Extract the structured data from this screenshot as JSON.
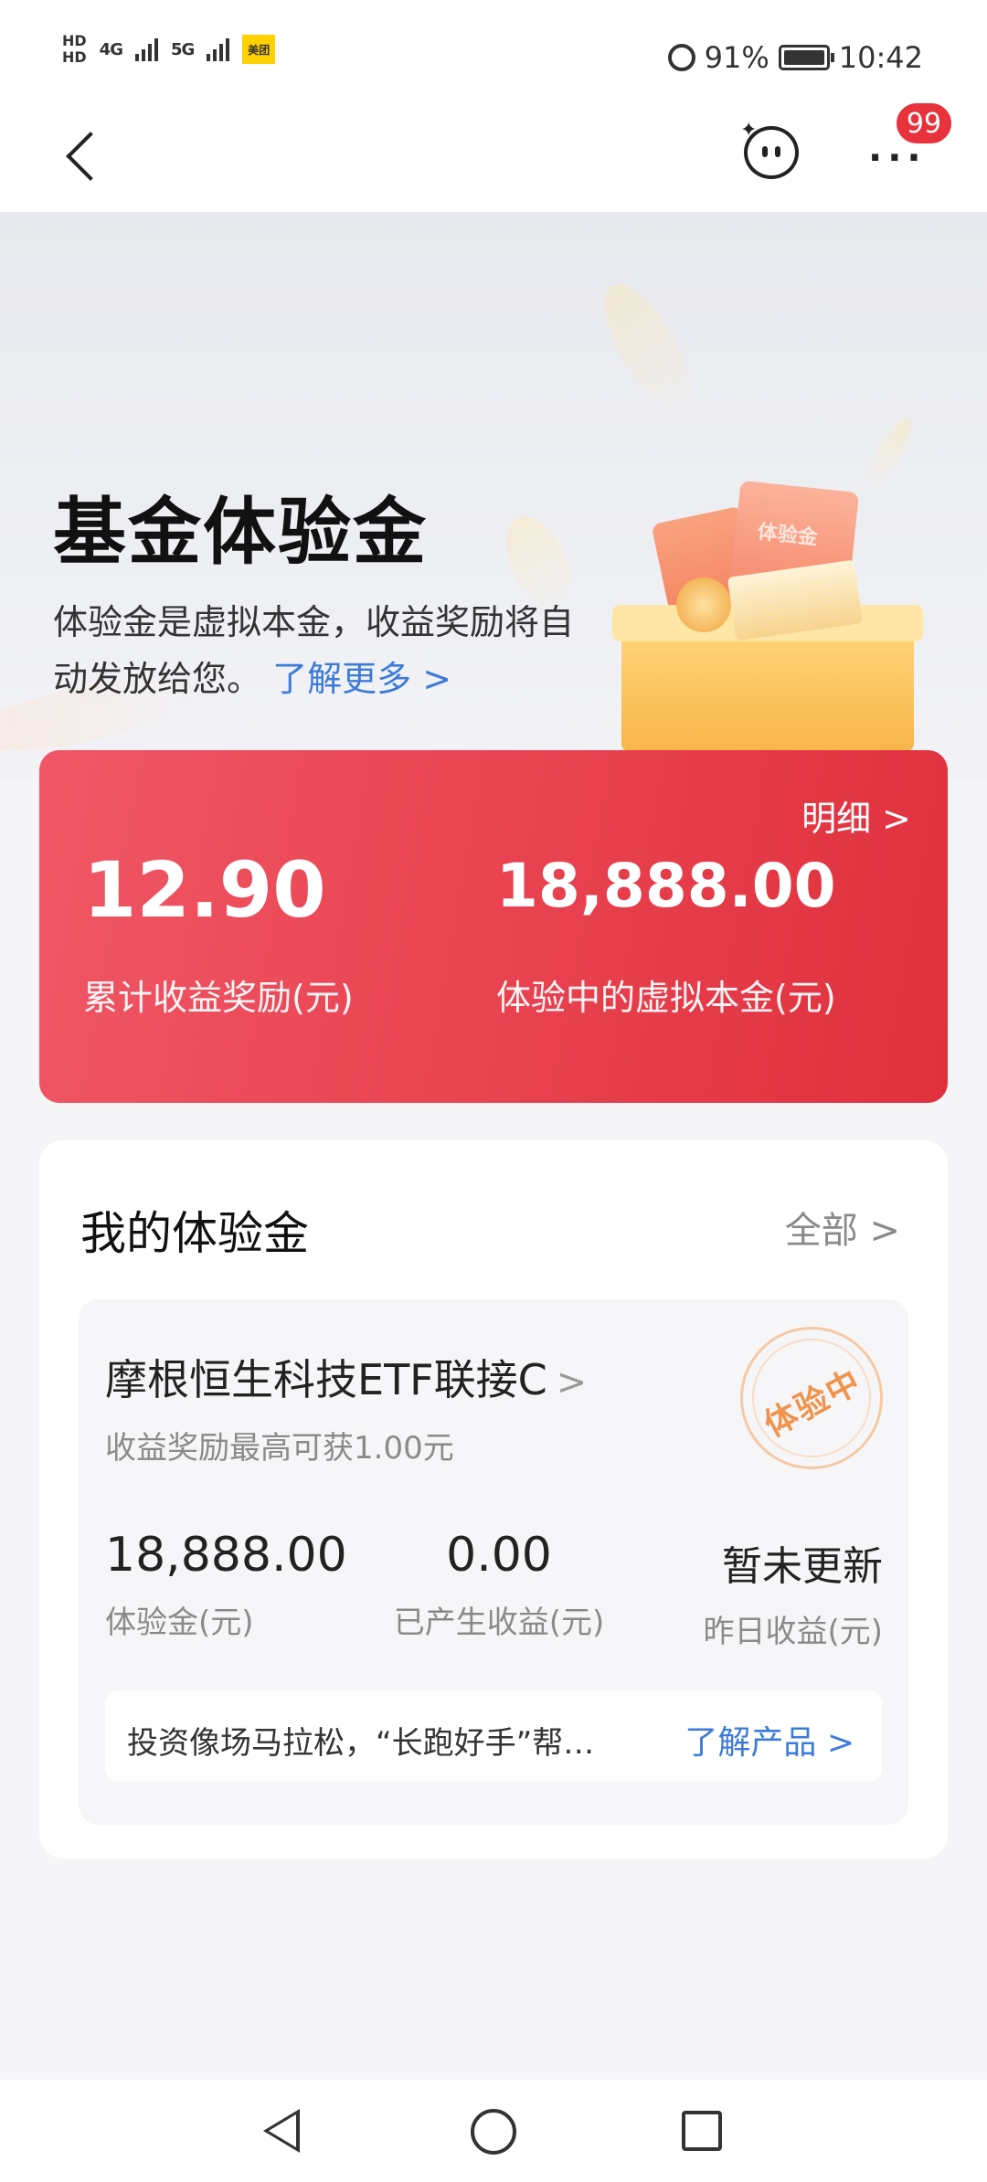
{
  "status_bar": {
    "hd1": "HD",
    "hd2": "HD",
    "net1": "4G",
    "net2": "5G",
    "app_badge": "美团",
    "battery": "91%",
    "time": "10:42"
  },
  "nav": {
    "badge_count": "99",
    "more_label": "···"
  },
  "hero": {
    "title": "基金体验金",
    "desc": "体验金是虚拟本金，收益奖励将自动发放给您。",
    "learn_more": "了解更多 >",
    "ticket_label": "体验金"
  },
  "summary": {
    "detail_link": "明细 >",
    "total_reward": "12.90",
    "total_reward_label": "累计收益奖励(元)",
    "virtual_principal": "18,888.00",
    "virtual_principal_label": "体验中的虚拟本金(元)"
  },
  "my_trial": {
    "title": "我的体验金",
    "all_link": "全部 >",
    "fund": {
      "name": "摩根恒生科技ETF联接C",
      "chevron": ">",
      "subtitle": "收益奖励最高可获1.00元",
      "status_stamp": "体验中",
      "trial_amount": "18,888.00",
      "trial_amount_label": "体验金(元)",
      "earned": "0.00",
      "earned_label": "已产生收益(元)",
      "yesterday": "暂未更新",
      "yesterday_label": "昨日收益(元)",
      "tip": "投资像场马拉松，“长跑好手”帮…",
      "tip_link": "了解产品 >"
    }
  },
  "colors": {
    "accent_red": "#e8404e",
    "link_blue": "#3d7bd9",
    "stamp_orange": "#f0944d"
  }
}
